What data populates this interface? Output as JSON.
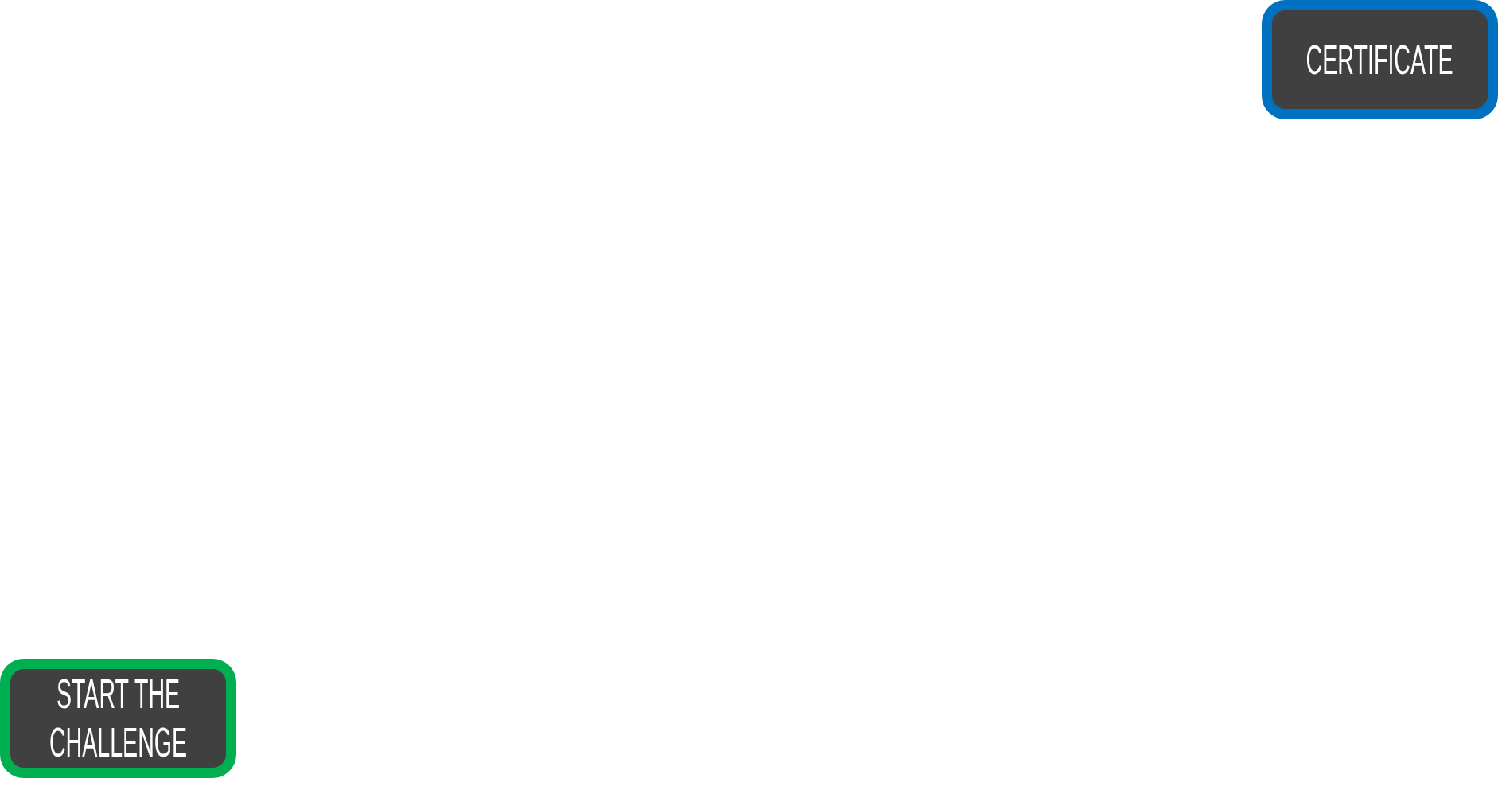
{
  "top_right_button": {
    "label": "CERTIFICATE",
    "color": "#0070c0"
  },
  "bottom_left_button": {
    "label": "START THE CHALLENGE",
    "color": "#00b050"
  }
}
